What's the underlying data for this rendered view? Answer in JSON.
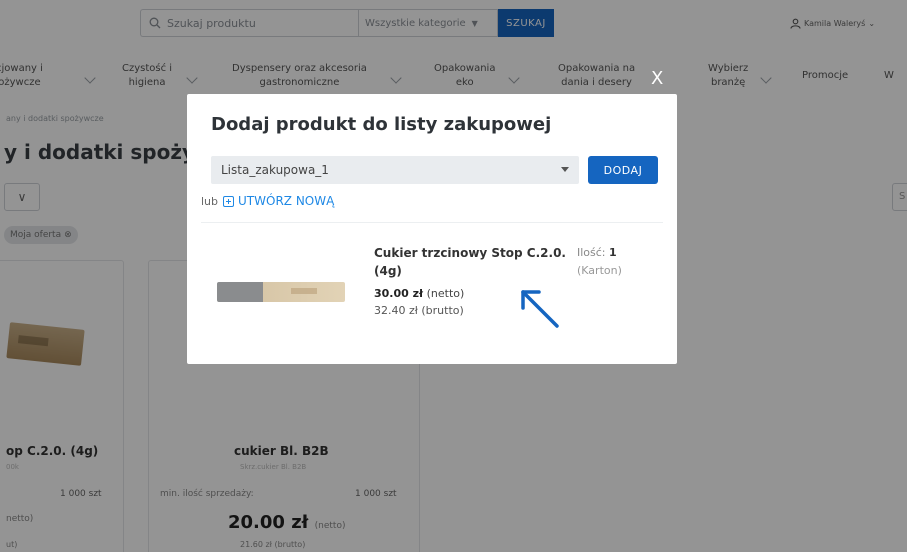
{
  "header": {
    "search_placeholder": "Szukaj produktu",
    "category_select": "Wszystkie kategorie",
    "search_button": "SZUKAJ",
    "user_name": "Kamila Waleryś"
  },
  "nav": {
    "items": [
      {
        "line1": "cjowany i",
        "line2": "ożywcze"
      },
      {
        "line1": "Czystość i",
        "line2": "higiena"
      },
      {
        "line1": "Dyspensery oraz akcesoria",
        "line2": "gastronomiczne"
      },
      {
        "line1": "Opakowania",
        "line2": "eko"
      },
      {
        "line1": "Opakowania na",
        "line2": "dania i desery"
      },
      {
        "line1": "Wybierz",
        "line2": "branżę"
      },
      {
        "line1": "Promocje",
        "line2": ""
      },
      {
        "line1": "W",
        "line2": ""
      }
    ]
  },
  "page": {
    "breadcrumb": "any i dodatki spożywcze",
    "title": "y i dodatki spożyw",
    "filter_chip": "Moja oferta",
    "right_edge": "S"
  },
  "cards": {
    "card1": {
      "name": "op C.2.0. (4g)",
      "sub": "00k",
      "qty": "1 000 szt",
      "price": "netto)",
      "bottom": "ut)"
    },
    "card2": {
      "name": "cukier Bl. B2B",
      "sub": "Skrz.cukier Bl. B2B",
      "min_label": "min. ilość sprzedaży:",
      "qty": "1 000 szt",
      "price": "20.00 zł",
      "price_suffix": "(netto)",
      "bottom": "21.60 zł (brutto)"
    }
  },
  "modal": {
    "close": "X",
    "title": "Dodaj produkt do listy zakupowej",
    "selected_list": "Lista_zakupowa_1",
    "add_button": "DODAJ",
    "or_text": "lub",
    "create_link": "UTWÓRZ NOWĄ",
    "product": {
      "name": "Cukier trzcinowy Stop C.2.0. (4g)",
      "net_price": "30.00 zł",
      "net_suffix": "(netto)",
      "gross": "32.40 zł (brutto)",
      "qty_label": "Ilość:",
      "qty_value": "1",
      "qty_unit": "(Karton)"
    }
  },
  "colors": {
    "accent": "#1565c0",
    "link": "#1e88e5",
    "overlay": "rgba(0,0,0,0.42)"
  }
}
